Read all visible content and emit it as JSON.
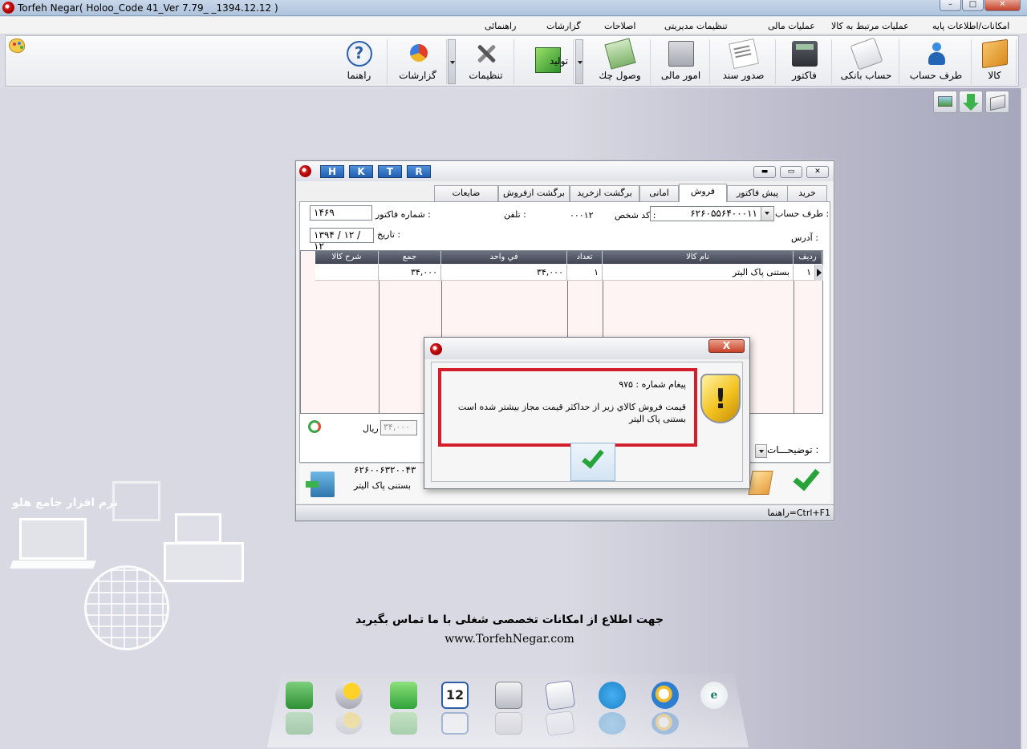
{
  "app": {
    "title": "Torfeh Negar( Holoo_Code 41_Ver 7.79_                    _1394.12.12 )",
    "window_controls": [
      "minimize",
      "maximize",
      "close"
    ]
  },
  "menu": {
    "items": [
      {
        "label": "امکانات/اطلاعات پایه"
      },
      {
        "label": "عملیات مرتبط به کالا"
      },
      {
        "label": "عملیات مالی"
      },
      {
        "label": "تنظیمات مدیریتی"
      },
      {
        "label": "اصلاحات"
      },
      {
        "label": "گزارشات"
      },
      {
        "label": "راهنمائی"
      }
    ]
  },
  "toolbar": {
    "items": [
      {
        "label": "کالا",
        "icon": "box-icon"
      },
      {
        "label": "طرف حساب",
        "icon": "person-icon"
      },
      {
        "label": "حساب بانکی",
        "icon": "bank-card-icon"
      },
      {
        "label": "فاکتور",
        "icon": "calculator-icon"
      },
      {
        "label": "صدور سند",
        "icon": "document-pen-icon"
      },
      {
        "label": "امور مالی",
        "icon": "abacus-icon"
      },
      {
        "label": "وصول چك",
        "icon": "cheque-icon"
      },
      {
        "label": "تولید",
        "icon": "cube-icon"
      },
      {
        "label": "تنظیمات",
        "icon": "tools-icon"
      },
      {
        "label": "گزارشات",
        "icon": "pie-chart-icon"
      },
      {
        "label": "راهنما",
        "icon": "help-icon"
      }
    ]
  },
  "invoice_window": {
    "hotkeys": [
      "H",
      "K",
      "T",
      "R"
    ],
    "tabs": [
      {
        "label": "خريد"
      },
      {
        "label": "پیش فاكتور"
      },
      {
        "label": "فروش"
      },
      {
        "label": "امانی"
      },
      {
        "label": "برگشت ازخريد"
      },
      {
        "label": "برگشت ازفروش"
      },
      {
        "label": "ضايعات"
      }
    ],
    "active_tab": "فروش",
    "fields": {
      "account_label": "طرف حساب :",
      "account_value": "۶۲۶۰۵۵۶۴۰۰۰۱۱",
      "person_code_label": "كد شخص :",
      "person_code_value": "۰۰۰۱۲",
      "phone_label": "تلفن :",
      "invoice_no_label": "شماره فاكتور :",
      "invoice_no_value": "۱۴۶۹",
      "address_label": "آدرس :",
      "date_label": "تاريخ :",
      "date_value": "۱۳۹۴ / ۱۲ / ۱۲"
    },
    "grid": {
      "columns": [
        "رديف",
        "نام كالا",
        "تعداد",
        "في واحد",
        "جمع",
        "شرح كالا"
      ],
      "rows": [
        {
          "row": "۱",
          "name": "بستنی پاک الیتر",
          "qty": "۱",
          "unit_price": "۳۴,۰۰۰",
          "total": "۳۴,۰۰۰",
          "desc": ""
        }
      ]
    },
    "total_box": "۳۴,۰۰۰",
    "currency": "ريال",
    "description_label": "توضيحـــات :",
    "footer_code": "۶۲۶۰۰۶۳۲۰۰۴۳",
    "footer_item": "بستنی پاک الیتر",
    "status_hint": "راهنما=Ctrl+F1"
  },
  "message_dialog": {
    "number_line": "پیغام شماره : ۹۷۵",
    "line1": "قیمت فروش كالاي زير از حداكثر قيمت مجاز بيشتر شده است",
    "line2": "بستنی پاک الیتر",
    "close_label": "X"
  },
  "desktop": {
    "brand": "نرم افزار جامع هلو",
    "contact_text": "جهت اطلاع از امكانات تخصصی شغلی با ما تماس بگيريد",
    "url": "www.TorfehNegar.com",
    "calendar_day": "12",
    "dock_icons": [
      "exit-icon",
      "weather-icon",
      "phone-icon",
      "calendar-icon",
      "calculator-icon",
      "notepad-icon",
      "telegram-icon",
      "internet-explorer-icon",
      "logo-icon"
    ]
  },
  "colors": {
    "highlight_border": "#d21f2b",
    "hotkey_blue": "#2d6fc2",
    "grid_header": "#505665"
  }
}
